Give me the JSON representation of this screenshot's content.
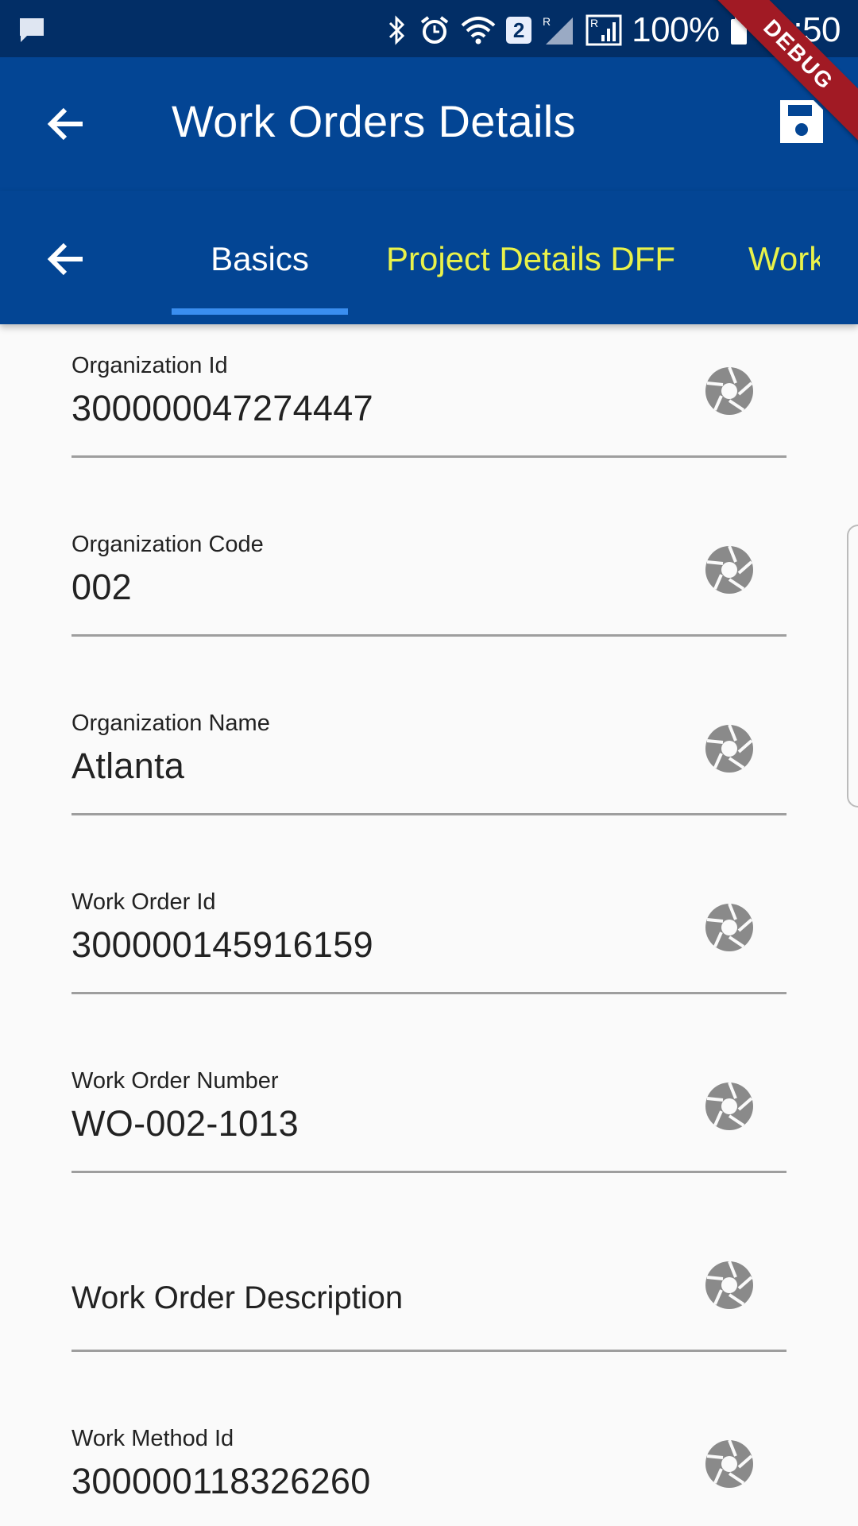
{
  "status_bar": {
    "battery": "100%",
    "time": "11:50",
    "sim_badge": "2",
    "sim_r_1": "R",
    "sim_r_2": "R"
  },
  "debug_banner": "DEBUG",
  "app_bar": {
    "title": "Work Orders Details"
  },
  "tabs": [
    {
      "label": "Basics"
    },
    {
      "label": "Project Details DFF"
    },
    {
      "label": "Work"
    }
  ],
  "fields": [
    {
      "label": "Organization Id",
      "value": "300000047274447"
    },
    {
      "label": "Organization Code",
      "value": "002"
    },
    {
      "label": "Organization Name",
      "value": "Atlanta"
    },
    {
      "label": "Work Order Id",
      "value": "300000145916159"
    },
    {
      "label": "Work Order Number",
      "value": "WO-002-1013"
    },
    {
      "label": "",
      "placeholder": "Work Order Description"
    },
    {
      "label": "Work Method Id",
      "value": "300000118326260"
    }
  ],
  "colors": {
    "status_bar": "#022e66",
    "app_bar": "#034594",
    "tab_active": "#ffffff",
    "tab_inactive": "#e9f24a",
    "indicator": "#3a8ef0",
    "debug_ribbon": "#a11a24",
    "icon_gray": "#8a8a8a"
  }
}
